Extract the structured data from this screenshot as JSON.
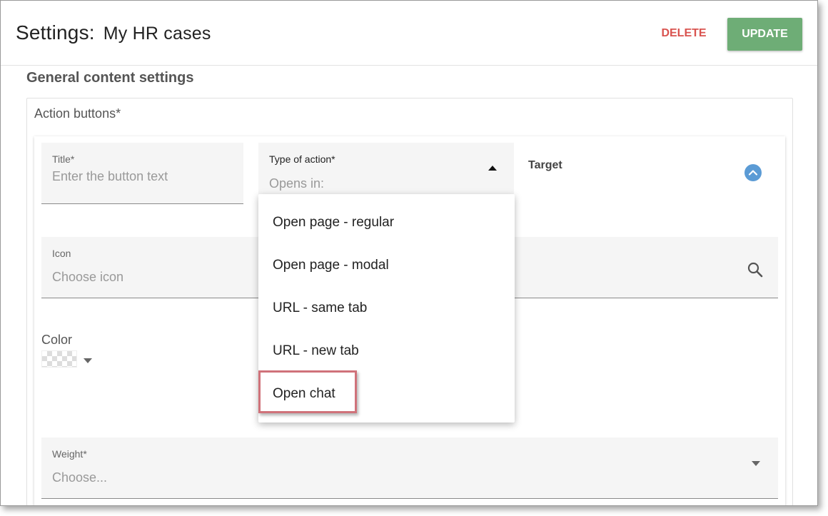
{
  "header": {
    "title": "Settings:",
    "page_name": "My HR cases",
    "delete_label": "DELETE",
    "update_label": "UPDATE"
  },
  "section_title": "General content settings",
  "action_buttons": {
    "group_label": "Action buttons*",
    "title_field": {
      "label": "Title*",
      "placeholder": "Enter the button text"
    },
    "type_field": {
      "label": "Type of action*",
      "placeholder": "Opens in:"
    },
    "target_label": "Target",
    "icon_field": {
      "label": "Icon",
      "placeholder": "Choose icon"
    },
    "color_label": "Color",
    "weight_field": {
      "label": "Weight*",
      "placeholder": "Choose..."
    }
  },
  "dropdown": {
    "items": [
      "Open page - regular",
      "Open page - modal",
      "URL - same tab",
      "URL - new tab",
      "Open chat"
    ],
    "highlighted_item": "Open chat"
  },
  "colors": {
    "update_bg": "#6ead76",
    "delete_text": "#d9534f",
    "accent_blue": "#5b9bd5",
    "highlight_border": "#d0727a"
  },
  "icons": {
    "collapse": "chevron-up-circle-icon",
    "search": "search-icon",
    "type_caret": "caret-up-icon",
    "color_caret": "caret-down-icon",
    "weight_caret": "caret-down-icon"
  }
}
